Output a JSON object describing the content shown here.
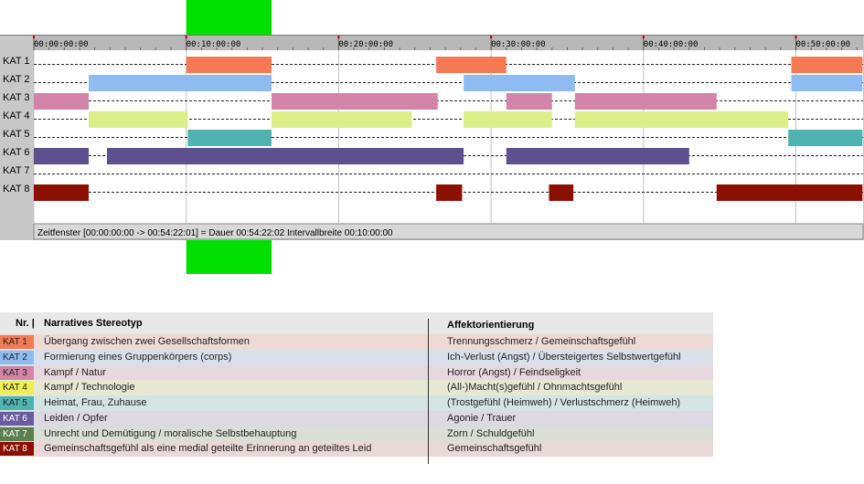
{
  "chart_data": {
    "type": "timeline",
    "x_unit": "minutes",
    "xlim": [
      0,
      54.37
    ],
    "tick_interval": 10,
    "tick_labels": [
      "00:00:00:00",
      "00:10:00:00",
      "00:20:00:00",
      "00:30:00:00",
      "00:40:00:00",
      "00:50:00:00"
    ],
    "highlight_range": [
      10.0,
      15.6
    ],
    "highlight_color": "#00e000",
    "categories": [
      "KAT 1",
      "KAT 2",
      "KAT 3",
      "KAT 4",
      "KAT 5",
      "KAT 6",
      "KAT 7",
      "KAT 8"
    ],
    "series": [
      {
        "name": "KAT 1",
        "color": "#f47a56",
        "intervals": [
          [
            10.0,
            15.6
          ],
          [
            26.4,
            31.0
          ],
          [
            49.7,
            54.37
          ]
        ]
      },
      {
        "name": "KAT 2",
        "color": "#8fbcf0",
        "intervals": [
          [
            3.6,
            15.6
          ],
          [
            28.2,
            35.5
          ],
          [
            49.7,
            54.37
          ]
        ]
      },
      {
        "name": "KAT 3",
        "color": "#d384a8",
        "intervals": [
          [
            0.0,
            3.6
          ],
          [
            15.6,
            26.5
          ],
          [
            31.0,
            34.0
          ],
          [
            35.5,
            44.8
          ]
        ]
      },
      {
        "name": "KAT 4",
        "color": "#dcee88",
        "intervals": [
          [
            3.6,
            10.1
          ],
          [
            15.6,
            24.8
          ],
          [
            28.2,
            34.0
          ],
          [
            35.5,
            49.5
          ]
        ]
      },
      {
        "name": "KAT 5",
        "color": "#4fb3b0",
        "intervals": [
          [
            10.1,
            15.6
          ],
          [
            49.5,
            54.37
          ]
        ]
      },
      {
        "name": "KAT 6",
        "color": "#5e4f91",
        "intervals": [
          [
            0.0,
            3.6
          ],
          [
            4.8,
            28.2
          ],
          [
            31.0,
            43.0
          ]
        ]
      },
      {
        "name": "KAT 7",
        "color": "#5c7f50",
        "intervals": []
      },
      {
        "name": "KAT 8",
        "color": "#8c1000",
        "intervals": [
          [
            0.0,
            3.6
          ],
          [
            26.4,
            28.1
          ],
          [
            33.8,
            35.4
          ],
          [
            44.8,
            54.37
          ]
        ]
      }
    ],
    "status_text": "Zeitfenster [00:00:00:00 -> 00:54:22:01] = Dauer 00:54:22:02    Intervallbreite 00:10:00:00"
  },
  "legend": {
    "headers": {
      "nr": "Nr. |",
      "stereotyp": "Narratives Stereotyp",
      "affekt": "Affektorientierung"
    },
    "rows": [
      {
        "kat": "KAT 1",
        "color": "#f47a56",
        "bg": "#efd9d4",
        "stereotyp": "Übergang zwischen zwei Gesellschaftsformen",
        "affekt": "Trennungsschmerz / Gemeinschaftsgefühl"
      },
      {
        "kat": "KAT 2",
        "color": "#8fbcf0",
        "bg": "#d8e1ea",
        "stereotyp": "Formierung eines Gruppenkörpers (corps)",
        "affekt": "Ich-Verlust (Angst) / Übersteigertes Selbstwertgefühl"
      },
      {
        "kat": "KAT 3",
        "color": "#d384a8",
        "bg": "#e6d8df",
        "stereotyp": "Kampf / Natur",
        "affekt": "Horror (Angst) / Feindseligkeit"
      },
      {
        "kat": "KAT 4",
        "color": "#eeee55",
        "bg": "#e6e8d4",
        "stereotyp": "Kampf / Technologie",
        "affekt": "(All-)Macht(s)gefühl / Ohnmachtsgefühl"
      },
      {
        "kat": "KAT 5",
        "color": "#4fb3b0",
        "bg": "#d4e4e2",
        "stereotyp": "Heimat, Frau, Zuhause",
        "affekt": "(Trostgefühl (Heimweh) / Verlustschmerz (Heimweh)"
      },
      {
        "kat": "KAT 6",
        "color": "#6a5a9e",
        "bg": "#dcd9e3",
        "stereotyp": "Leiden / Opfer",
        "affekt": "Agonie / Trauer"
      },
      {
        "kat": "KAT 7",
        "color": "#5c7f50",
        "bg": "#d9ded6",
        "stereotyp": "Unrecht und Demütigung / moralische Selbstbehauptung",
        "affekt": "Zorn / Schuldgefühl"
      },
      {
        "kat": "KAT 8",
        "color": "#8c1000",
        "bg": "#e8d8d8",
        "stereotyp": "Gemeinschaftsgefühl als eine medial geteilte Erinnerung an geteiltes Leid",
        "affekt": "Gemeinschaftsgefühl"
      }
    ]
  }
}
